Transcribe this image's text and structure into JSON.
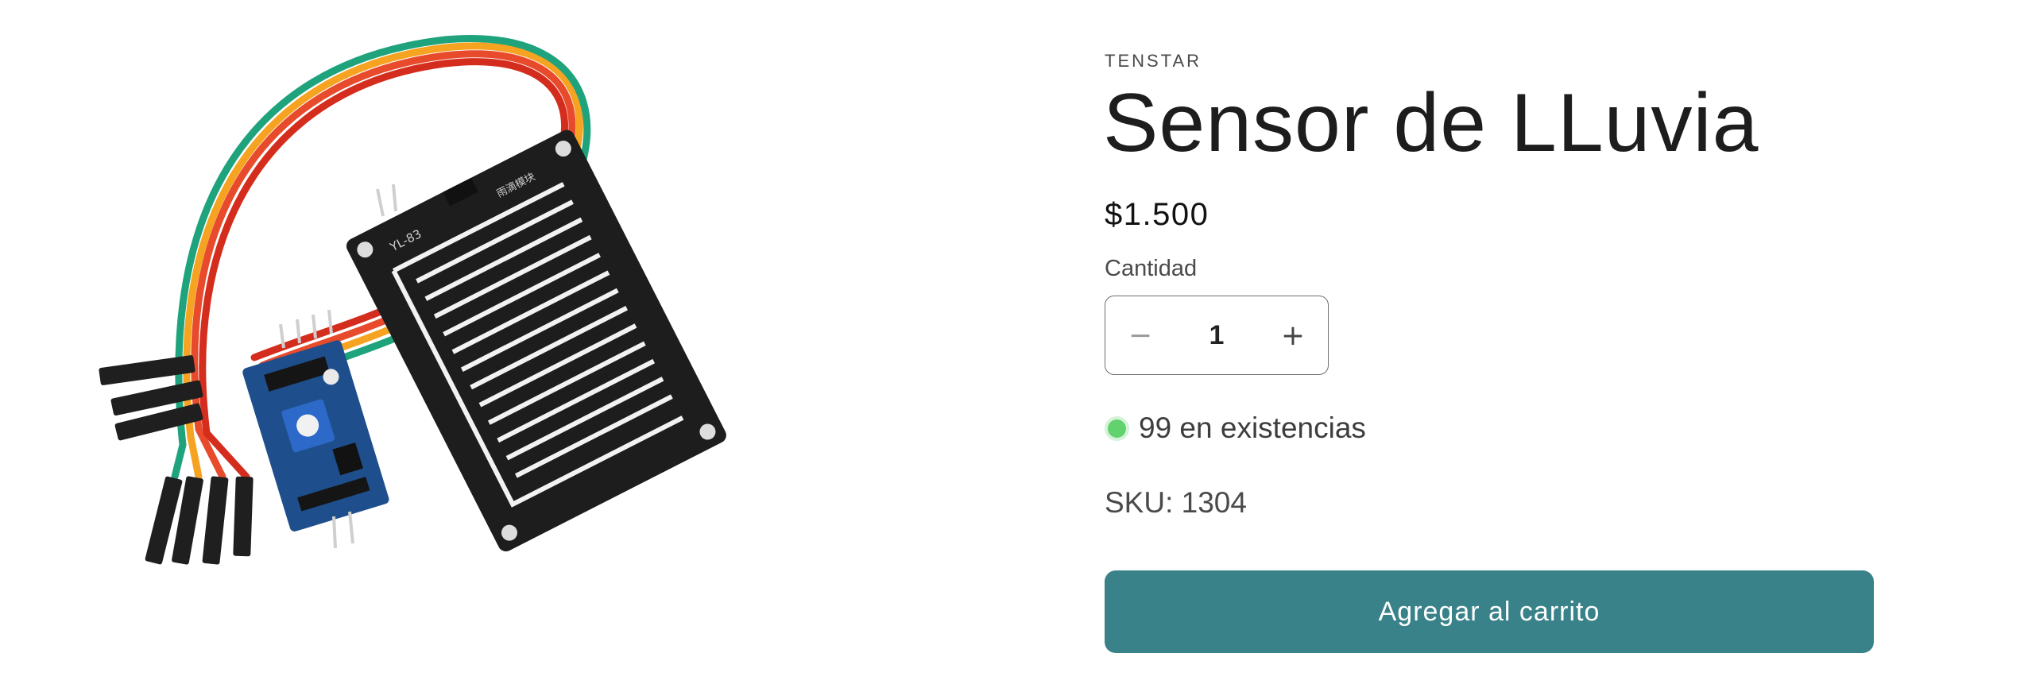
{
  "product": {
    "vendor": "TENSTAR",
    "title": "Sensor de LLuvia",
    "price": "$1.500",
    "quantity_label": "Cantidad",
    "quantity_value": "1",
    "decrease_symbol": "−",
    "increase_symbol": "+",
    "stock_text": "99 en existencias",
    "sku_text": "SKU: 1304",
    "add_to_cart_label": "Agregar al carrito",
    "board_label": "YL-83",
    "board_label_cn": "雨滴模块",
    "image_icon": "rain-sensor-product-image"
  },
  "colors": {
    "accent": "#3a8289",
    "stock_dot": "#62d26f"
  }
}
